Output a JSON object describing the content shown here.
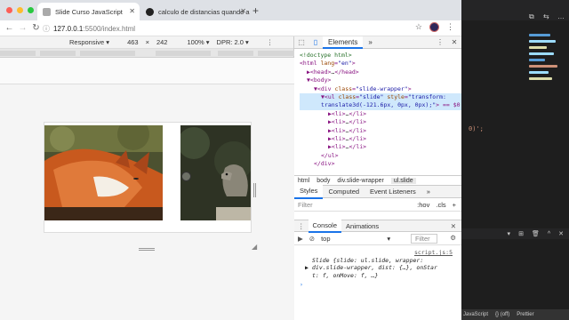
{
  "browser": {
    "tabs": [
      {
        "title": "Slide Curso JavaScript",
        "active": true
      },
      {
        "title": "calculo de distancias quando a",
        "active": false
      }
    ],
    "url": {
      "host": "127.0.0.1",
      "path": ":5500/index.html"
    }
  },
  "device_toolbar": {
    "mode": "Responsive",
    "width": "463",
    "times": "×",
    "height": "242",
    "zoom": "100%",
    "dpr": "DPR: 2.0"
  },
  "devtools": {
    "panel_tab": "Elements",
    "more": "»",
    "dom": [
      {
        "indent": 0,
        "parts": [
          [
            "cm",
            "<!doctype html>"
          ]
        ]
      },
      {
        "indent": 0,
        "parts": [
          [
            "tag",
            "<html "
          ],
          [
            "attr",
            "lang"
          ],
          [
            "tag",
            "="
          ],
          [
            "val",
            "\"en\""
          ],
          [
            "tag",
            ">"
          ]
        ]
      },
      {
        "indent": 1,
        "parts": [
          [
            "tag",
            "▶<head>"
          ],
          [
            "txt",
            "…"
          ],
          [
            "tag",
            "</head>"
          ]
        ]
      },
      {
        "indent": 1,
        "parts": [
          [
            "tag",
            "▼<body>"
          ]
        ]
      },
      {
        "indent": 2,
        "parts": [
          [
            "tag",
            "▼<div "
          ],
          [
            "attr",
            "class"
          ],
          [
            "tag",
            "="
          ],
          [
            "val",
            "\"slide-wrapper\""
          ],
          [
            "tag",
            ">"
          ]
        ]
      },
      {
        "indent": 3,
        "hl": true,
        "parts": [
          [
            "tag",
            "▼<ul "
          ],
          [
            "attr",
            "class"
          ],
          [
            "tag",
            "="
          ],
          [
            "val",
            "\"slide\" "
          ],
          [
            "attr",
            "style"
          ],
          [
            "tag",
            "="
          ],
          [
            "val",
            "\"transform:"
          ]
        ]
      },
      {
        "indent": 3,
        "hl": true,
        "parts": [
          [
            "val",
            "translate3d(-121.6px, 0px, 0px);\""
          ],
          [
            "tag",
            "> == $0"
          ]
        ]
      },
      {
        "indent": 4,
        "parts": [
          [
            "tag",
            "▶<li>"
          ],
          [
            "txt",
            "…"
          ],
          [
            "tag",
            "</li>"
          ]
        ]
      },
      {
        "indent": 4,
        "parts": [
          [
            "tag",
            "▶<li>"
          ],
          [
            "txt",
            "…"
          ],
          [
            "tag",
            "</li>"
          ]
        ]
      },
      {
        "indent": 4,
        "parts": [
          [
            "tag",
            "▶<li>"
          ],
          [
            "txt",
            "…"
          ],
          [
            "tag",
            "</li>"
          ]
        ]
      },
      {
        "indent": 4,
        "parts": [
          [
            "tag",
            "▶<li>"
          ],
          [
            "txt",
            "…"
          ],
          [
            "tag",
            "</li>"
          ]
        ]
      },
      {
        "indent": 4,
        "parts": [
          [
            "tag",
            "▶<li>"
          ],
          [
            "txt",
            "…"
          ],
          [
            "tag",
            "</li>"
          ]
        ]
      },
      {
        "indent": 3,
        "parts": [
          [
            "tag",
            "</ul>"
          ]
        ]
      },
      {
        "indent": 2,
        "parts": [
          [
            "tag",
            "</div>"
          ]
        ]
      }
    ],
    "breadcrumbs": [
      "html",
      "body",
      "div.slide-wrapper",
      "ul.slide"
    ],
    "styles_tabs": [
      "Styles",
      "Computed",
      "Event Listeners",
      "»"
    ],
    "filter_placeholder": "Filter",
    "hov": ":hov",
    "cls": ".cls",
    "plus": "+",
    "drawer_tabs": [
      "Console",
      "Animations"
    ],
    "context": "top",
    "console_filter": "Filter",
    "console_source": "script.js:5",
    "console_line1": "Slide {slide: ul.slide, wrapper:",
    "console_line2": "div.slide-wrapper, dist: {…}, onStar",
    "console_line3": "t: f, onMove: f, …}",
    "prompt": "›"
  },
  "editor": {
    "code_snippet": "0)';",
    "status": [
      "JavaScript",
      "{} (off)",
      "Prettier"
    ]
  },
  "colors": {
    "accent": "#1a73e8",
    "highlight": "#cfe8fc",
    "tag": "#881280"
  }
}
